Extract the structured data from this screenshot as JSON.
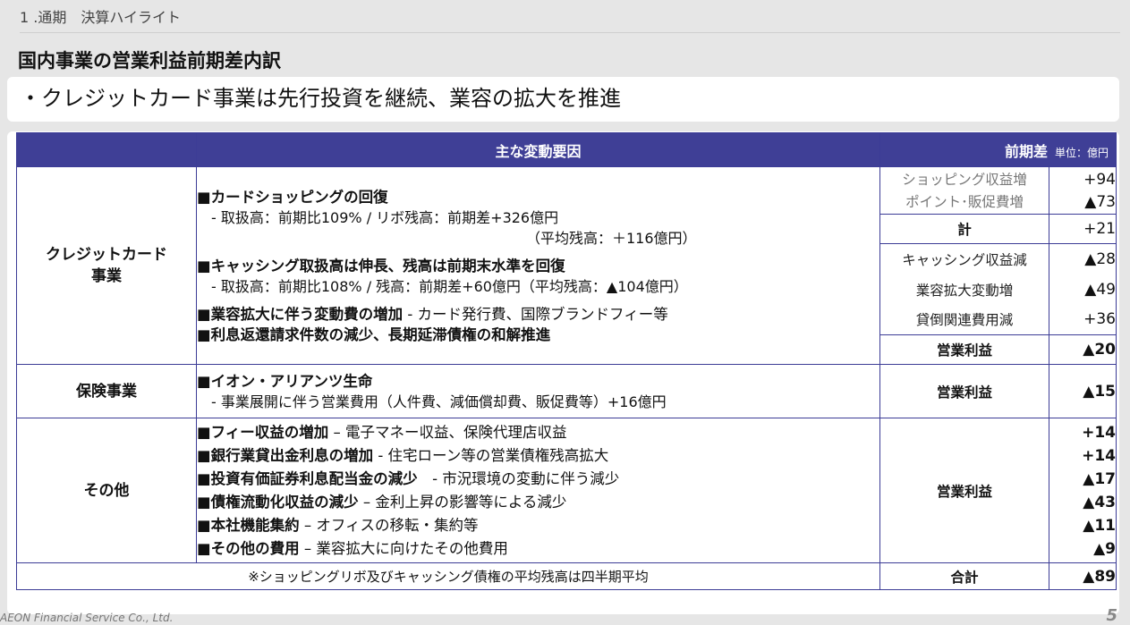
{
  "header": {
    "section": "1 .通期　決算ハイライト",
    "title": "国内事業の営業利益前期差内訳",
    "lead": "・クレジットカード事業は先行投資を継続、業容の拡大を推進"
  },
  "table": {
    "col_factors": "主な変動要因",
    "col_diff": "前期差",
    "unit": "単位：億円",
    "credit": {
      "category": "クレジットカード\n事業",
      "items": [
        {
          "title": "■カードショッピングの回復",
          "sub": "- 取扱高：前期比109% / リボ残高：前期差+326億円",
          "sub2": "（平均残高：＋116億円）"
        },
        {
          "title": "■キャッシング取扱高は伸長、残高は前期末水準を回復",
          "sub": "- 取扱高：前期比108% / 残高：前期差+60億円（平均残高：▲104億円）"
        },
        {
          "title": "■業容拡大に伴う変動費の増加",
          "desc": " - カード発行費、国際ブランドフィー等"
        },
        {
          "title": "■利息返還請求件数の減少、長期延滞債権の和解推進"
        }
      ],
      "breakdown": [
        {
          "label": "ショッピング収益増",
          "value": "+94"
        },
        {
          "label": "ポイント･販促費増",
          "value": "▲73"
        },
        {
          "label": "計",
          "value": "+21"
        },
        {
          "label": "キャッシング収益減",
          "value": "▲28"
        },
        {
          "label": "業容拡大変動増",
          "value": "▲49"
        },
        {
          "label": "貸倒関連費用減",
          "value": "+36"
        },
        {
          "label": "営業利益",
          "value": "▲20"
        }
      ]
    },
    "insurance": {
      "category": "保険事業",
      "title": "■イオン・アリアンツ生命",
      "sub": "- 事業展開に伴う営業費用（人件費、減価償却費、販促費等）+16億円",
      "label": "営業利益",
      "value": "▲15"
    },
    "other": {
      "category": "その他",
      "items": [
        {
          "title": "■フィー収益の増加",
          "desc": " – 電子マネー収益、保険代理店収益",
          "value": "+14"
        },
        {
          "title": "■銀行業貸出金利息の増加",
          "desc": " - 住宅ローン等の営業債権残高拡大",
          "value": "+14"
        },
        {
          "title": "■投資有価証券利息配当金の減少",
          "desc": "　- 市況環境の変動に伴う減少",
          "value": "▲17"
        },
        {
          "title": "■債権流動化収益の減少",
          "desc": " – 金利上昇の影響等による減少",
          "value": "▲43"
        },
        {
          "title": "■本社機能集約",
          "desc": " – オフィスの移転・集約等",
          "value": "▲11"
        },
        {
          "title": "■その他の費用",
          "desc": " – 業容拡大に向けたその他費用",
          "value": "▲9"
        }
      ],
      "label": "営業利益"
    },
    "note": "※ショッピングリボ及びキャッシング債権の平均残高は四半期平均",
    "total_label": "合計",
    "total_value": "▲89"
  },
  "footer": {
    "company": "AEON Financial Service Co., Ltd.",
    "page": "5"
  }
}
